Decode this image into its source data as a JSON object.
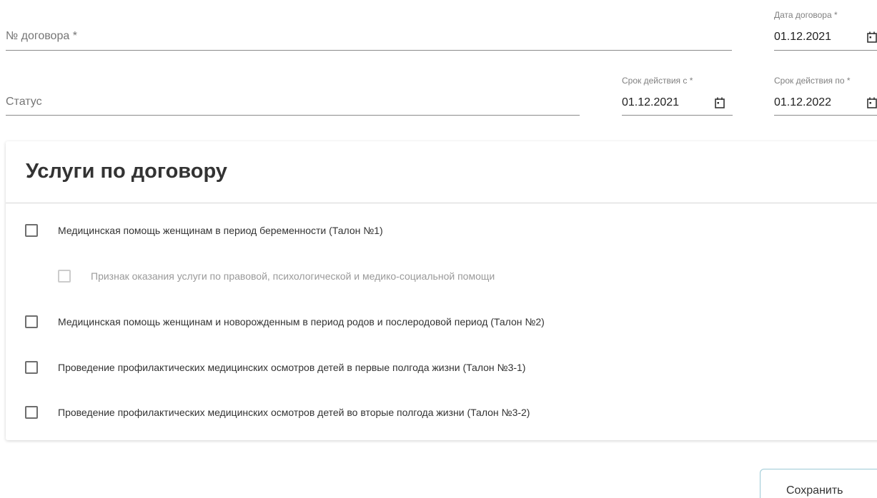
{
  "form": {
    "contract_number": {
      "placeholder": "№ договора *",
      "value": ""
    },
    "contract_date": {
      "label": "Дата договора *",
      "value": "01.12.2021"
    },
    "status": {
      "placeholder": "Статус",
      "value": ""
    },
    "valid_from": {
      "label": "Срок действия с *",
      "value": "01.12.2021"
    },
    "valid_to": {
      "label": "Срок действия по *",
      "value": "01.12.2022"
    }
  },
  "services_card": {
    "title": "Услуги по договору",
    "items": [
      {
        "label": "Медицинская помощь женщинам в период беременности (Талон №1)",
        "checked": false,
        "disabled": false
      },
      {
        "label": "Признак оказания услуги по правовой, психологической и медико-социальной помощи",
        "checked": false,
        "disabled": true
      },
      {
        "label": "Медицинская помощь женщинам и новорожденным в период родов и послеродовой период (Талон №2)",
        "checked": false,
        "disabled": false
      },
      {
        "label": "Проведение профилактических медицинских осмотров детей в первые полгода жизни (Талон №3-1)",
        "checked": false,
        "disabled": false
      },
      {
        "label": "Проведение профилактических медицинских осмотров детей во вторые полгода жизни (Талон №3-2)",
        "checked": false,
        "disabled": false
      }
    ]
  },
  "actions": {
    "save_label": "Сохранить"
  },
  "icons": {
    "calendar": "calendar-icon"
  },
  "colors": {
    "save_border": "#9cc9d6",
    "underline": "#8a8a8a"
  }
}
